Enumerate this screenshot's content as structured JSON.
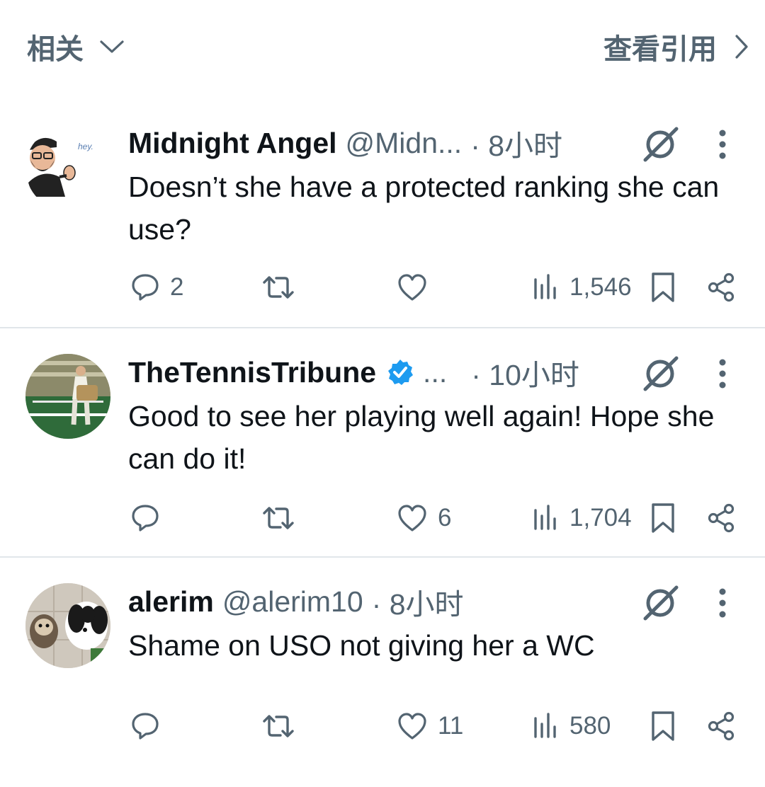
{
  "header": {
    "related_label": "相关",
    "quotes_label": "查看引用"
  },
  "posts": [
    {
      "name": "Midnight Angel",
      "handle": "@Midn...",
      "time": "· 8小时",
      "verified": false,
      "text": "Doesn’t she have a protected ranking she can use?",
      "avatar_caption": "hey.",
      "replies": "2",
      "likes": "",
      "views": "1,546"
    },
    {
      "name": "TheTennisTribune",
      "handle": "...",
      "time": "· 10小时",
      "verified": true,
      "text": "Good to see her playing well again! Hope she can do it!",
      "replies": "",
      "likes": "6",
      "views": "1,704"
    },
    {
      "name": "alerim",
      "handle": "@alerim10",
      "time": "· 8小时",
      "verified": false,
      "text": "Shame on USO not giving her a WC",
      "replies": "",
      "likes": "11",
      "views": "580"
    }
  ],
  "colors": {
    "text_primary": "#0f1419",
    "text_secondary": "#536471",
    "verified_blue": "#1d9bf0",
    "divider": "#e1e6ea"
  },
  "icons": {
    "related_dropdown": "chevron-down-icon",
    "view_quotes": "chevron-right-icon",
    "reply": "reply-icon",
    "repost": "repost-icon",
    "like": "heart-icon",
    "views": "views-icon",
    "bookmark": "bookmark-icon",
    "share": "share-icon",
    "grok": "grok-icon",
    "more": "more-icon",
    "verified": "verified-badge-icon"
  }
}
